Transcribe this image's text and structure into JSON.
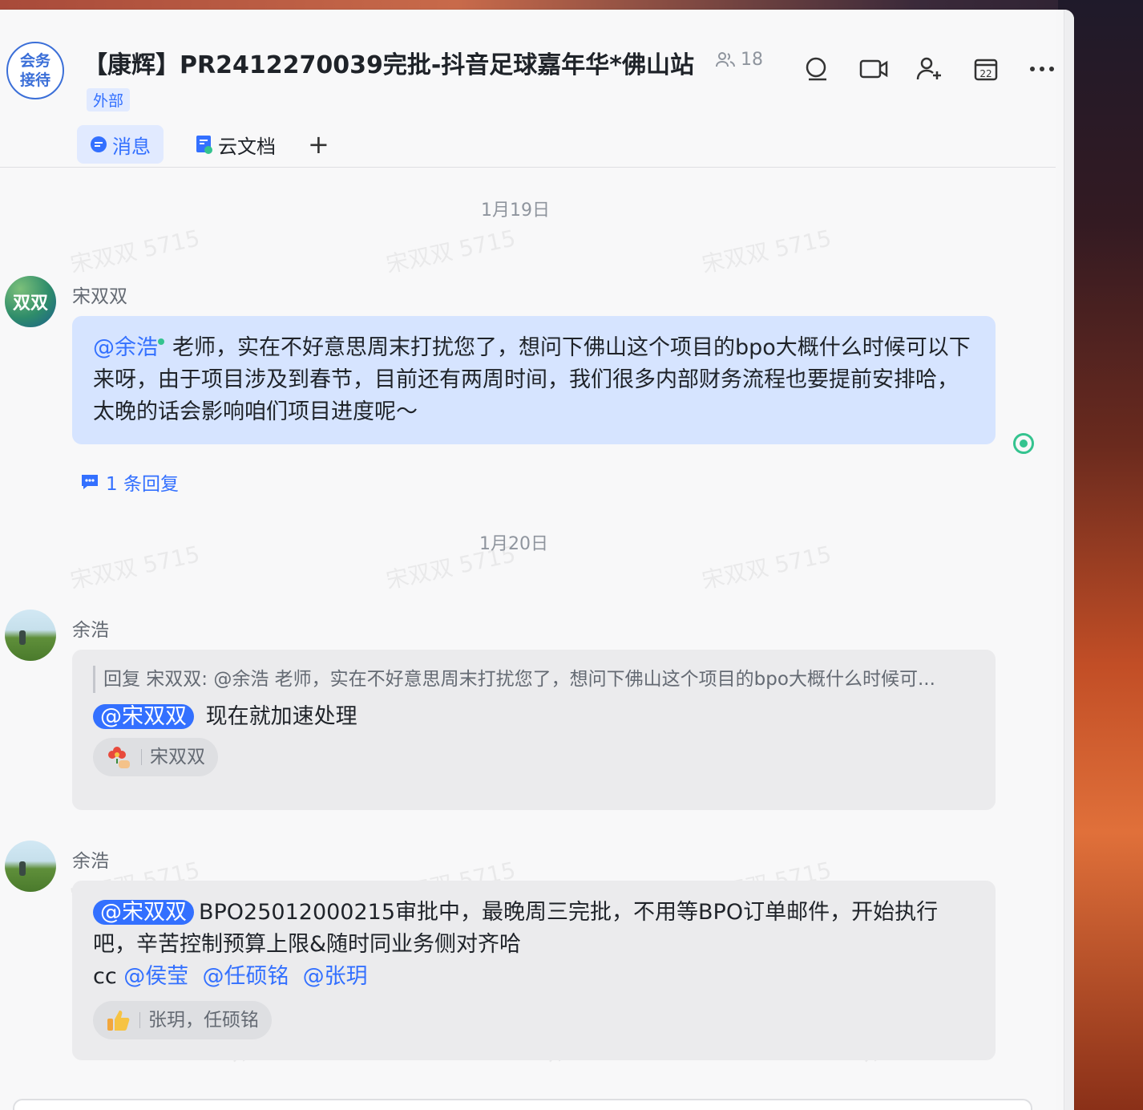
{
  "chat": {
    "avatar_line1": "会务",
    "avatar_line2": "接待",
    "title": "【康辉】PR2412270039完批-抖音足球嘉年华*佛山站",
    "member_count": "18",
    "external_tag": "外部"
  },
  "tabs": [
    {
      "label": "消息",
      "icon": "message-icon"
    },
    {
      "label": "云文档",
      "icon": "doc-icon"
    }
  ],
  "tab_add": "+",
  "header_icons": [
    "search-icon",
    "video-call-icon",
    "add-member-icon",
    "calendar-icon",
    "more-icon"
  ],
  "calendar_day": "22",
  "watermark": "宋双双 5715",
  "messages": [
    {
      "date": "1月19日",
      "sender": "宋双双",
      "avatar_text": "双双",
      "mention": "@余浩",
      "text": "老师，实在不好意思周末打扰您了，想问下佛山这个项目的bpo大概什么时候可以下来呀，由于项目涉及到春节，目前还有两周时间，我们很多内部财务流程也要提前安排哈，太晚的话会影响咱们项目进度呢～",
      "reply_count": "1 条回复"
    },
    {
      "date": "1月20日",
      "sender": "余浩",
      "quote": "回复 宋双双: @余浩 老师，实在不好意思周末打扰您了，想问下佛山这个项目的bpo大概什么时候可...",
      "mention": "@宋双双",
      "text": "现在就加速处理",
      "reaction_names": "宋双双",
      "reaction_icon": "flower-emoji-icon"
    },
    {
      "sender": "余浩",
      "mention": "@宋双双",
      "text_line1": "BPO25012000215审批中，最晚周三完批，不用等BPO订单邮件，开始执行",
      "text_line2": "吧，辛苦控制预算上限&随时同业务侧对齐哈",
      "cc_prefix": "cc",
      "cc_mentions": [
        "@侯莹",
        "@任硕铭",
        "@张玥"
      ],
      "reaction_names": "张玥，任硕铭",
      "reaction_icon": "thumbs-up-emoji-icon"
    }
  ],
  "colors": {
    "accent": "#3370ff",
    "bubble_mine": "#d6e4ff",
    "bubble_other": "#ebebed",
    "online": "#34c38f"
  }
}
